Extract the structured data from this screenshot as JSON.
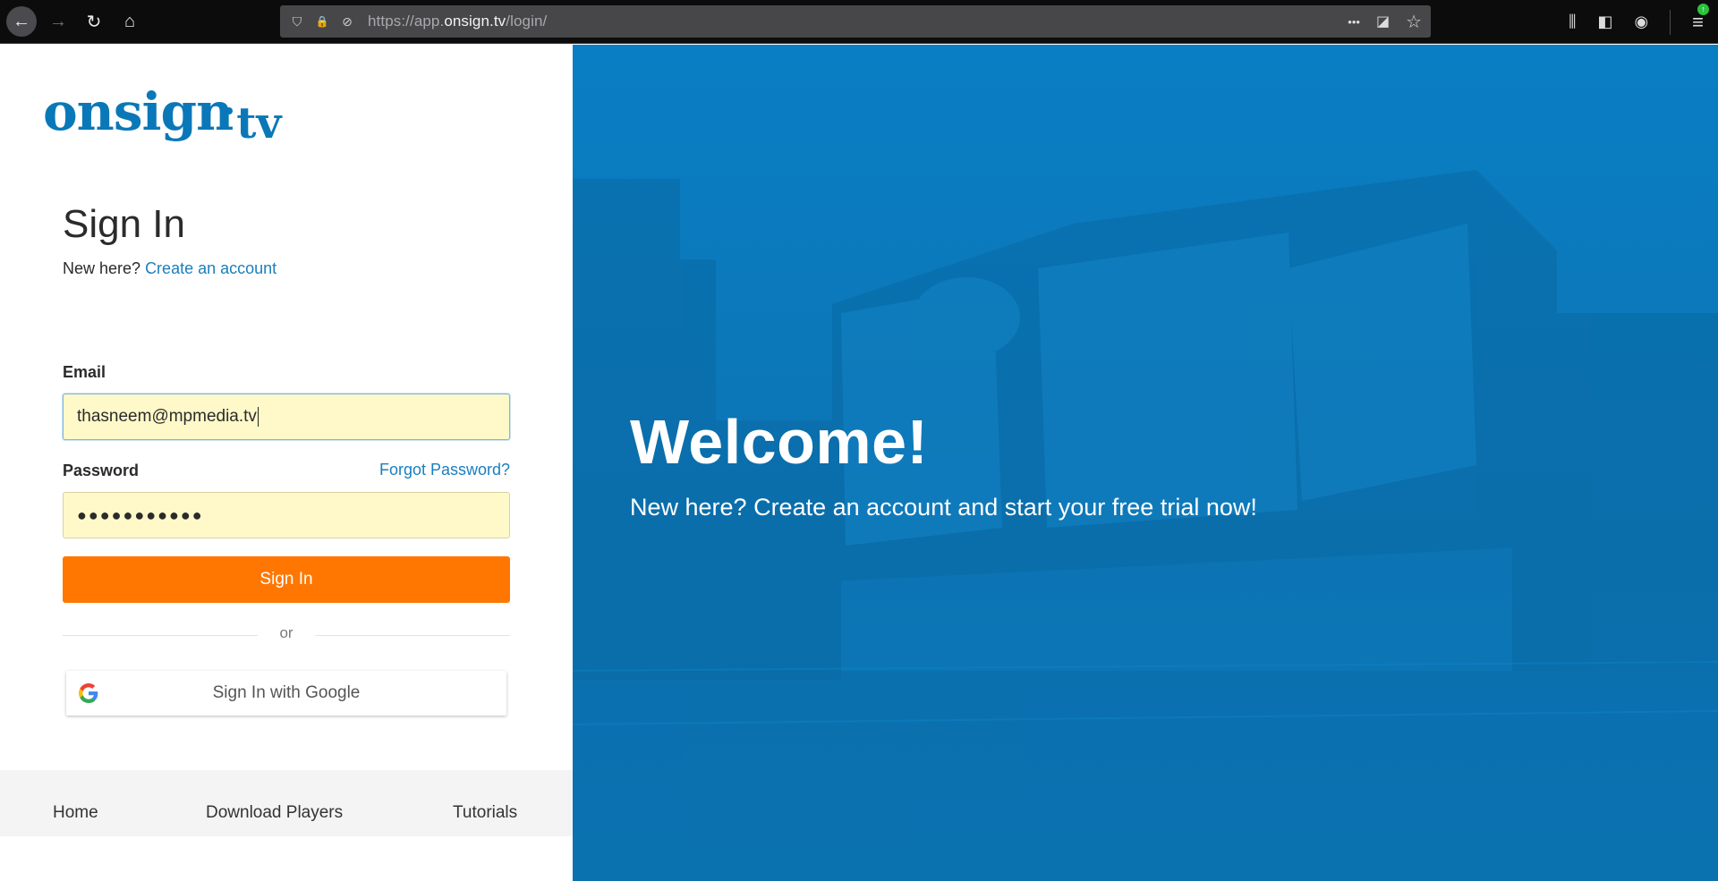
{
  "browser": {
    "url_prefix": "https://app.",
    "url_domain": "onsign.tv",
    "url_path": "/login/",
    "icons": {
      "back": "arrow-left-icon",
      "forward": "arrow-right-icon",
      "reload": "reload-icon",
      "home": "home-icon",
      "shield": "shield-icon",
      "lock": "lock-icon",
      "tracking": "tracking-protection-icon",
      "more": "more-icon",
      "pocket": "pocket-icon",
      "bookmark": "star-icon",
      "library": "library-icon",
      "sidebar": "sidebar-icon",
      "account": "account-icon",
      "menu": "hamburger-menu-icon"
    },
    "glyphs": {
      "back": "←",
      "forward": "→",
      "reload": "↻",
      "home": "⌂",
      "shield": "⛉",
      "lock": "🔒",
      "tracking": "⊘",
      "more": "•••",
      "pocket": "◪",
      "bookmark": "☆",
      "library": "⫼",
      "sidebar": "◧",
      "account": "◉",
      "menu": "≡",
      "update_badge": "↑"
    }
  },
  "login": {
    "logo_main": "onsign",
    "logo_tv": "tv",
    "title": "Sign In",
    "new_here": "New here?",
    "create_account": "Create an account",
    "email_label": "Email",
    "email_value": "thasneem@mpmedia.tv",
    "password_label": "Password",
    "forgot_password": "Forgot Password?",
    "password_mask": "●●●●●●●●●●●",
    "signin_button": "Sign In",
    "or": "or",
    "google_button": "Sign In with Google"
  },
  "footer": {
    "links": [
      "Home",
      "Download Players",
      "Tutorials"
    ]
  },
  "hero": {
    "title": "Welcome!",
    "subtitle": "New here? Create an account and start your free trial now!"
  },
  "colors": {
    "brand_blue": "#0a78b8",
    "link_blue": "#1b7fbd",
    "hero_blue": "#0d7fc1",
    "orange": "#ff7700",
    "autofill_yellow": "#fff9c9"
  }
}
